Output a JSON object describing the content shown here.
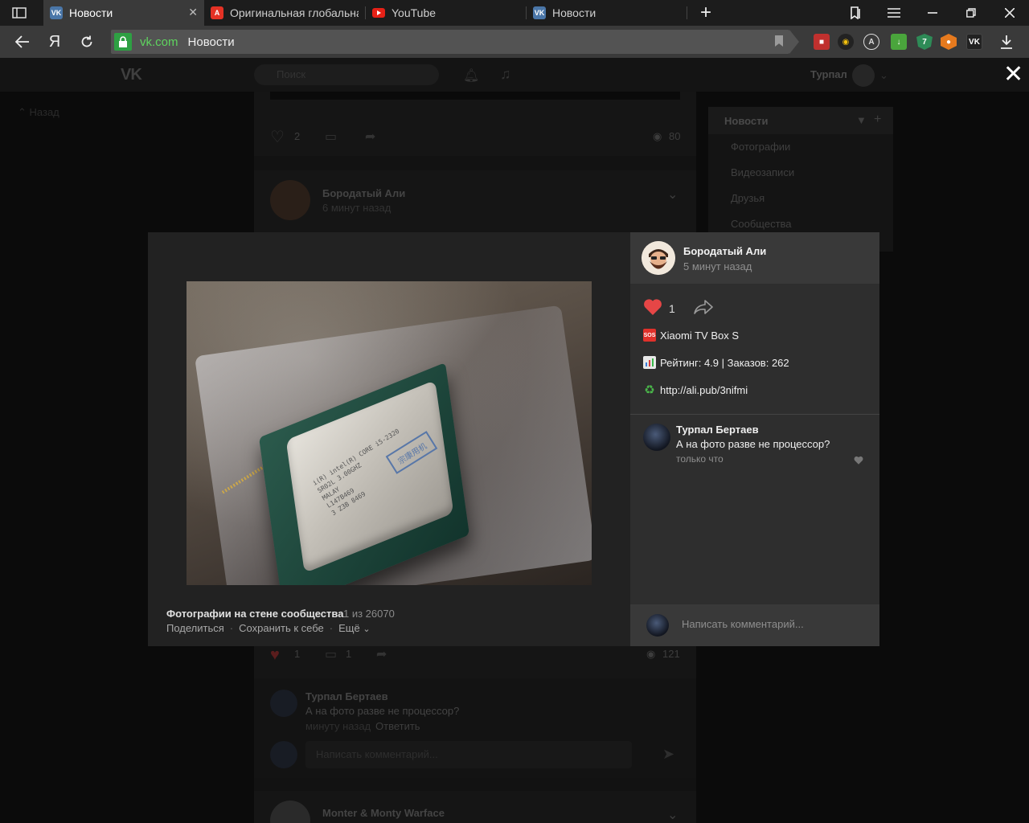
{
  "browser": {
    "tabs": [
      {
        "title": "Новости",
        "favicon": "vk-icon",
        "active": true
      },
      {
        "title": "Оригинальная глобальная",
        "favicon": "aliexpress-icon",
        "active": false
      },
      {
        "title": "YouTube",
        "favicon": "youtube-icon",
        "active": false
      },
      {
        "title": "Новости",
        "favicon": "vk-icon",
        "active": false
      }
    ],
    "new_tab": "+",
    "yandex_label": "Я",
    "address": {
      "domain": "vk.com",
      "page_title": "Новости"
    }
  },
  "vk": {
    "logo": "VK",
    "search_placeholder": "Поиск",
    "user_name": "Турпал",
    "back_label": "Назад",
    "right_menu": [
      "Новости",
      "Фотографии",
      "Видеозаписи",
      "Друзья",
      "Сообщества"
    ],
    "top_post": {
      "likes": "2",
      "views": "80"
    },
    "post2": {
      "author": "Бородатый Али",
      "time": "6 минут назад"
    },
    "post2_stats": {
      "likes": "1",
      "comments": "1",
      "views": "121"
    },
    "bg_comment": {
      "author": "Турпал Бертаев",
      "text": "А на фото разве не процессор?",
      "time": "минуту назад",
      "reply": "Ответить"
    },
    "bg_comment_placeholder": "Написать комментарий...",
    "post3": {
      "author": "Monter & Monty Warface"
    }
  },
  "viewer": {
    "caption_title": "Фотографии на стене сообщества",
    "counter": "1 из 26070",
    "actions": {
      "share": "Поделиться",
      "save": "Сохранить к себе",
      "more": "Ещё"
    },
    "photo_ihs_text": "i(R) intel(R) CORE i5-2320\nSR02L 3.00GHZ\nMALAY\nL147B469\n3 Z3B 8469",
    "photo_stamp": "宗康用机",
    "author": {
      "name": "Бородатый Али",
      "time": "5 минут назад"
    },
    "likes": "1",
    "post_lines": [
      {
        "icon": "sos-emoji-icon",
        "text": "Xiaomi TV Box S"
      },
      {
        "icon": "chart-emoji-icon",
        "text": "Рейтинг: 4.9 | Заказов: 262"
      },
      {
        "icon": "recycle-emoji-icon",
        "text": "http://ali.pub/3nifmi"
      }
    ],
    "comment": {
      "author": "Турпал Бертаев",
      "text": "А на фото разве не процессор?",
      "time": "только что"
    },
    "comment_placeholder": "Написать комментарий..."
  },
  "colors": {
    "like_red": "#e64646",
    "secure_green": "#2ea043",
    "domain_green": "#5fd45f"
  }
}
